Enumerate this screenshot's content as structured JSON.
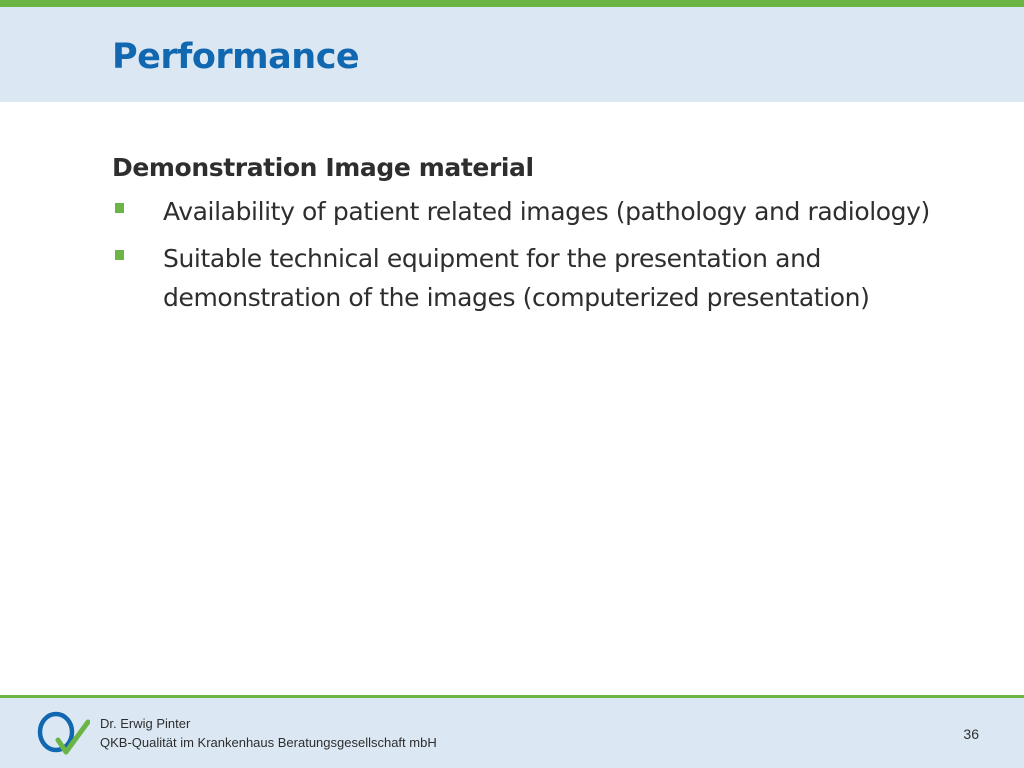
{
  "slide": {
    "title": "Performance",
    "subheading": "Demonstration Image material",
    "bullets": [
      "Availability of patient related images (pathology and radiology)",
      "Suitable technical equipment for the presentation and demonstration of the images (computerized presentation)"
    ]
  },
  "footer": {
    "author": "Dr. Erwig Pinter",
    "organization": "QKB-Qualität im Krankenhaus Beratungsgesellschaft mbH",
    "page_number": "36",
    "logo_icon": "qkb-q-checkmark-logo"
  },
  "colors": {
    "accent_green": "#6ab545",
    "title_blue": "#1168b0",
    "band_light_blue": "#dbe8f3",
    "text_dark": "#2e2e2e"
  }
}
